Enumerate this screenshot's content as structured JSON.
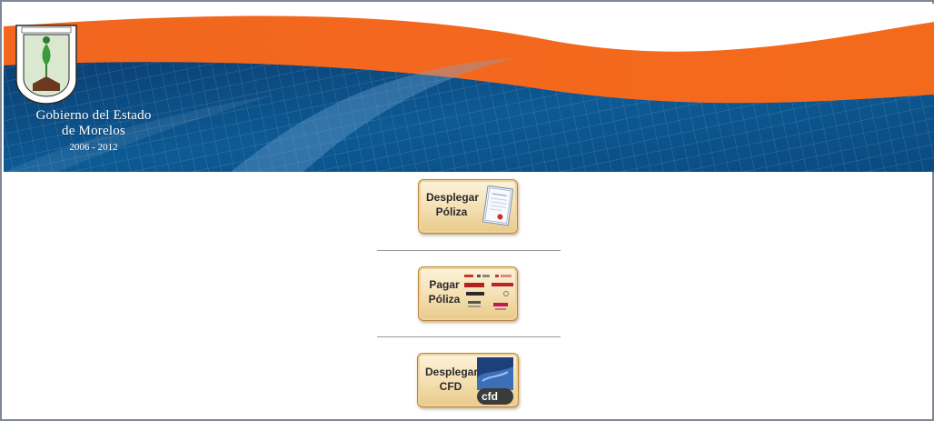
{
  "header": {
    "title_line1": "Gobierno del Estado",
    "title_line2": "de Morelos",
    "years": "2006 - 2012",
    "colors": {
      "orange": "#f26522",
      "blue": "#0b4f86"
    }
  },
  "actions": [
    {
      "label_line1": "Desplegar",
      "label_line2": "Póliza",
      "icon": "certificate-icon"
    },
    {
      "label_line1": "Pagar",
      "label_line2": "Póliza",
      "icon": "bank-logos-icon"
    },
    {
      "label_line1": "Desplegar",
      "label_line2": "CFD",
      "icon": "cfd-icon",
      "badge": "cfd"
    }
  ]
}
